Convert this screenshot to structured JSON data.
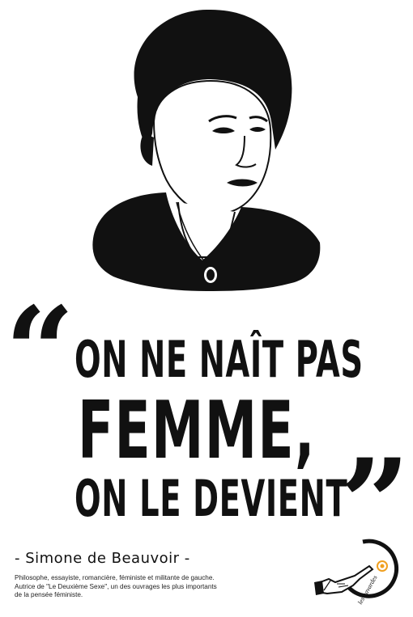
{
  "quote": {
    "line1": "ON NE NAÎT PAS",
    "line2": "FEMME,",
    "line3": "ON LE DEVIENT"
  },
  "author": {
    "name": "- Simone de Beauvoir -",
    "bio_line1": "Philosophe, essayiste, romancière, féministe et militante de gauche.",
    "bio_line2": "Autrice de \"Le Deuxième Sexe\", un des ouvrages les plus importants",
    "bio_line3": "de la pensée féministe."
  },
  "logo": {
    "text": "les bavardes",
    "icon": "pointing-hand-icon",
    "accent_color": "#f0a020"
  }
}
